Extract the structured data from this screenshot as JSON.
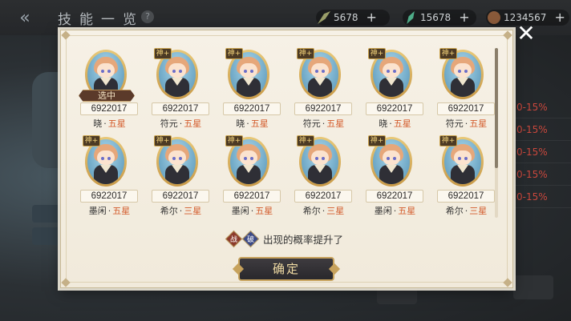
{
  "header": {
    "back_icon": "back-chevron-icon",
    "title": "技能一览",
    "help_label": "?"
  },
  "resources": [
    {
      "icon": "wing-icon",
      "value": "5678",
      "plus": "+"
    },
    {
      "icon": "feather-icon",
      "value": "15678",
      "plus": "+"
    },
    {
      "icon": "bag-icon",
      "value": "1234567",
      "plus": "+"
    }
  ],
  "background_rates": [
    "0-15%",
    "0-15%",
    "0-15%",
    "0-15%",
    "0-15%"
  ],
  "modal": {
    "close_label": "✕",
    "heroes": [
      {
        "id": "6922017",
        "name": "晓",
        "star": "五星",
        "badge": "",
        "selected": "选中"
      },
      {
        "id": "6922017",
        "name": "符元",
        "star": "五星",
        "badge": "神+",
        "selected": ""
      },
      {
        "id": "6922017",
        "name": "晓",
        "star": "五星",
        "badge": "神+",
        "selected": ""
      },
      {
        "id": "6922017",
        "name": "符元",
        "star": "五星",
        "badge": "神+",
        "selected": ""
      },
      {
        "id": "6922017",
        "name": "晓",
        "star": "五星",
        "badge": "神+",
        "selected": ""
      },
      {
        "id": "6922017",
        "name": "符元",
        "star": "五星",
        "badge": "神+",
        "selected": ""
      },
      {
        "id": "6922017",
        "name": "墨闲",
        "star": "五星",
        "badge": "神+",
        "selected": ""
      },
      {
        "id": "6922017",
        "name": "希尔",
        "star": "三星",
        "badge": "神+",
        "selected": ""
      },
      {
        "id": "6922017",
        "name": "墨闲",
        "star": "五星",
        "badge": "神+",
        "selected": ""
      },
      {
        "id": "6922017",
        "name": "希尔",
        "star": "三星",
        "badge": "神+",
        "selected": ""
      },
      {
        "id": "6922017",
        "name": "墨闲",
        "star": "五星",
        "badge": "神+",
        "selected": ""
      },
      {
        "id": "6922017",
        "name": "希尔",
        "star": "三星",
        "badge": "神+",
        "selected": ""
      }
    ],
    "notice": {
      "tag1": "战",
      "tag2": "破",
      "text": "出现的概率提升了"
    },
    "confirm_label": "确定"
  }
}
